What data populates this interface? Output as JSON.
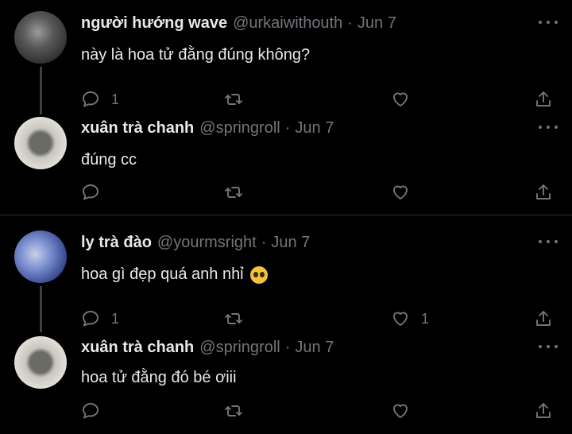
{
  "tweets": [
    {
      "name": "người hướng wave",
      "handle": "@urkaiwithouth",
      "dot": "·",
      "date": "Jun 7",
      "text": "này là hoa tử đằng đúng không?",
      "reply_count": "1",
      "like_count": "",
      "avatar_colors": [
        "#6f6f6f",
        "#2c2c2c"
      ]
    },
    {
      "name": "xuân trà chanh",
      "handle": "@springroll",
      "dot": "·",
      "date": "Jun 7",
      "text": "đúng cc",
      "reply_count": "",
      "like_count": "",
      "avatar_colors": [
        "#d8d5cf",
        "#8a8a84"
      ]
    },
    {
      "name": "ly trà đào",
      "handle": "@yourmsright",
      "dot": "·",
      "date": "Jun 7",
      "text": "hoa gì đẹp quá anh nhỉ",
      "emoji": "pleading-face",
      "reply_count": "1",
      "like_count": "1",
      "avatar_colors": [
        "#7f93c9",
        "#2a3a78"
      ]
    },
    {
      "name": "xuân trà chanh",
      "handle": "@springroll",
      "dot": "·",
      "date": "Jun 7",
      "text": "hoa tử đằng đó bé ơiii",
      "reply_count": "",
      "like_count": "",
      "avatar_colors": [
        "#d8d5cf",
        "#8a8a84"
      ]
    }
  ],
  "icons": {
    "reply": "reply-icon",
    "retweet": "retweet-icon",
    "like": "heart-icon",
    "share": "share-icon",
    "more": "more-options-icon"
  },
  "colors": {
    "background": "#000000",
    "text": "#e7e9ea",
    "muted": "#71767b",
    "divider": "#2f3336"
  }
}
